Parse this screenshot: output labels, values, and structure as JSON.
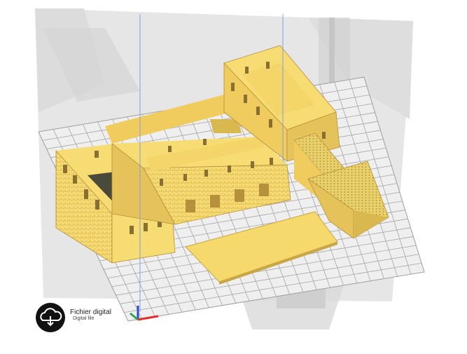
{
  "app": {
    "view": "3D build plate preview"
  },
  "badge": {
    "title": "Fichier digital",
    "subtitle": "Digital file",
    "icon": "cloud-download-icon"
  },
  "axes": {
    "x_color": "#e8292a",
    "y_color": "#2ea44f",
    "z_color": "#2a4bd7",
    "guide_color": "#7fa0e6"
  },
  "colors": {
    "model": "#f7dc74",
    "model_shade": "#d9b84f",
    "model_dark": "#b4913a",
    "plate": "#e9e9e9",
    "grid_line": "#a9a9a9",
    "machine_frame": "#d7d7d7"
  },
  "models": [
    "building-left-wing",
    "building-center-hall",
    "building-right-wing",
    "roof-gabled",
    "base-plate"
  ]
}
